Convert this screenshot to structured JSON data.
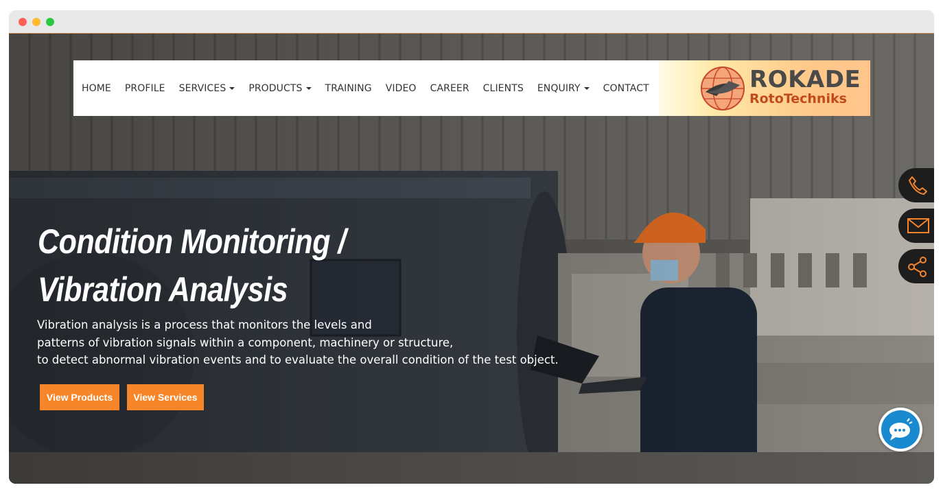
{
  "nav": {
    "items": [
      {
        "label": "HOME",
        "dropdown": false
      },
      {
        "label": "PROFILE",
        "dropdown": false
      },
      {
        "label": "SERVICES",
        "dropdown": true
      },
      {
        "label": "PRODUCTS",
        "dropdown": true
      },
      {
        "label": "TRAINING",
        "dropdown": false
      },
      {
        "label": "VIDEO",
        "dropdown": false
      },
      {
        "label": "CAREER",
        "dropdown": false
      },
      {
        "label": "CLIENTS",
        "dropdown": false
      },
      {
        "label": "ENQUIRY",
        "dropdown": true
      },
      {
        "label": "CONTACT",
        "dropdown": false
      }
    ]
  },
  "logo": {
    "name": "ROKADE",
    "subtitle": "RotoTechniks"
  },
  "hero": {
    "title_line1": "Condition Monitoring /",
    "title_line2": "Vibration Analysis",
    "desc_line1": "Vibration analysis is a process that monitors the levels and",
    "desc_line2": "patterns of vibration signals within a component, machinery or structure,",
    "desc_line3": "to detect abnormal vibration events and to evaluate the overall condition of the test object.",
    "button_products": "View Products",
    "button_services": "View Services"
  },
  "side_icons": [
    "phone-icon",
    "mail-icon",
    "share-icon",
    "chat-icon"
  ],
  "colors": {
    "accent": "#f7862a",
    "side_bg": "#1d1d1d",
    "chat": "#1a8ad0"
  }
}
